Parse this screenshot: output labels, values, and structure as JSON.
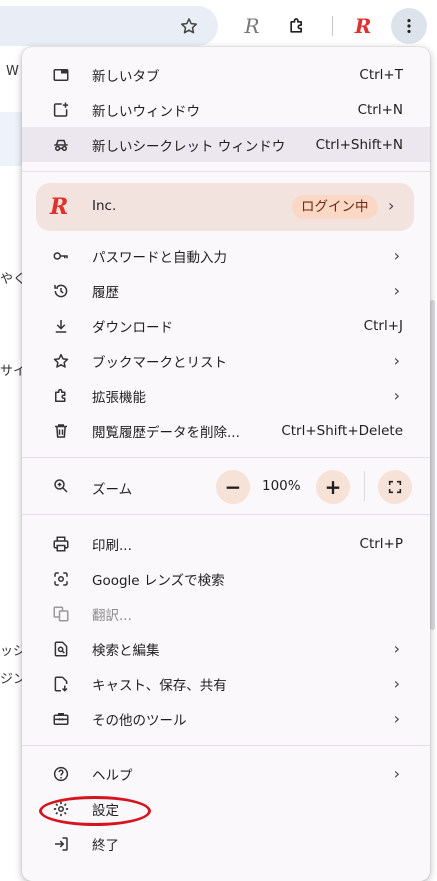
{
  "background": {
    "left_texts": [
      "W",
      "やくる",
      "サイ",
      "ッジ",
      "ジン"
    ]
  },
  "menu": {
    "group1": [
      {
        "name": "new-tab",
        "label": "新しいタブ",
        "shortcut": "Ctrl+T"
      },
      {
        "name": "new-window",
        "label": "新しいウィンドウ",
        "shortcut": "Ctrl+N"
      },
      {
        "name": "new-incognito-window",
        "label": "新しいシークレット ウィンドウ",
        "shortcut": "Ctrl+Shift+N"
      }
    ],
    "profile": {
      "name": "Inc.",
      "badge": "ログイン中"
    },
    "group2": [
      {
        "name": "passwords-autofill",
        "label": "パスワードと自動入力"
      },
      {
        "name": "history",
        "label": "履歴"
      },
      {
        "name": "downloads",
        "label": "ダウンロード",
        "shortcut": "Ctrl+J"
      },
      {
        "name": "bookmarks-lists",
        "label": "ブックマークとリスト"
      },
      {
        "name": "extensions",
        "label": "拡張機能"
      },
      {
        "name": "clear-browsing-data",
        "label": "閲覧履歴データを削除...",
        "shortcut": "Ctrl+Shift+Delete"
      }
    ],
    "zoom": {
      "label": "ズーム",
      "minus": "−",
      "value": "100%",
      "plus": "+"
    },
    "group3": [
      {
        "name": "print",
        "label": "印刷...",
        "shortcut": "Ctrl+P"
      },
      {
        "name": "google-lens",
        "label": "Google レンズで検索"
      },
      {
        "name": "translate",
        "label": "翻訳..."
      },
      {
        "name": "find-edit",
        "label": "検索と編集"
      },
      {
        "name": "cast-save-share",
        "label": "キャスト、保存、共有"
      },
      {
        "name": "more-tools",
        "label": "その他のツール"
      }
    ],
    "group4": [
      {
        "name": "help",
        "label": "ヘルプ"
      },
      {
        "name": "settings",
        "label": "設定"
      },
      {
        "name": "exit",
        "label": "終了"
      }
    ]
  },
  "colors": {
    "menu_bg": "#fbf8fc",
    "profile_bg": "#f3e3df",
    "badge_bg": "#fbd7c5",
    "annotation": "#d6141f",
    "logo": "#e0312c"
  }
}
